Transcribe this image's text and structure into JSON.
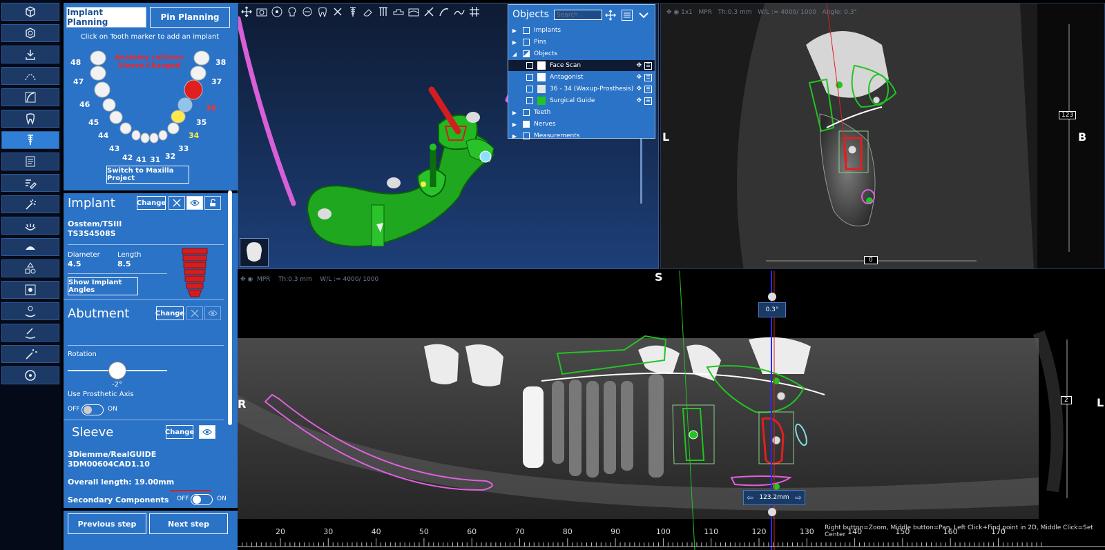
{
  "panel": {
    "tabs": [
      {
        "label": "Implant Planning"
      },
      {
        "label": "Pin Planning"
      }
    ],
    "hint": "Click on Tooth marker to add an implant",
    "warning_line1": "Anatomy collision",
    "warning_line2": "Sleeve Changed",
    "teeth": {
      "t48": "48",
      "t47": "47",
      "t46": "46",
      "t45": "45",
      "t44": "44",
      "t43": "43",
      "t42": "42",
      "t41": "41",
      "t31": "31",
      "t32": "32",
      "t33": "33",
      "t34": "34",
      "t35": "35",
      "t36": "36",
      "t37": "37",
      "t38": "38"
    },
    "switch_label": "Switch to Maxilla Project",
    "implant": {
      "title": "Implant",
      "change": "Change",
      "brand": "Osstem/TSIII",
      "model": "TS3S4508S",
      "diameter_label": "Diameter",
      "diameter": "4.5",
      "length_label": "Length",
      "length": "8.5",
      "angles_label": "Show Implant Angles"
    },
    "abutment": {
      "title": "Abutment",
      "change": "Change",
      "rotation_label": "Rotation",
      "rotation_value": "-2°",
      "rotation_fraction": 0.5,
      "prosthetic_axis_label": "Use Prosthetic Axis",
      "off": "OFF",
      "on": "ON"
    },
    "sleeve": {
      "title": "Sleeve",
      "change": "Change",
      "brand": "3Diemme/RealGUIDE",
      "model": "3DM00604CAD1.10",
      "overall_length": "Overall length: 19.00mm",
      "secondary_label": "Secondary Components",
      "off": "OFF",
      "on": "ON"
    },
    "prev_label": "Previous step",
    "next_label": "Next step"
  },
  "objects": {
    "title": "Objects",
    "search_placeholder": "Search",
    "rows": [
      {
        "label": "Implants"
      },
      {
        "label": "Pins"
      },
      {
        "label": "Objects"
      },
      {
        "label": "Face Scan"
      },
      {
        "label": "Antagonist"
      },
      {
        "label": "36 - 34 (Waxup-Prosthesis)"
      },
      {
        "label": "Surgical Guide"
      },
      {
        "label": "Teeth"
      },
      {
        "label": "Nerves"
      },
      {
        "label": "Measurements"
      }
    ],
    "colors": {
      "face_scan": "#ffffff",
      "antagonist": "#ffffff",
      "waxup": "#e6e6e6",
      "guide": "#22c422"
    }
  },
  "cross_view": {
    "zoom": "1x1",
    "mode": "MPR",
    "thickness": "Th:0.3 mm",
    "wl": "W/L := 4000/ 1000",
    "angle": "Angle: 0.3°",
    "left_letter": "L",
    "right_letter": "B",
    "slider_value": "123",
    "bottom_value": "0"
  },
  "pano_view": {
    "mode": "MPR",
    "thickness": "Th:0.3 mm",
    "wl": "W/L := 4000/ 1000",
    "top_letter": "S",
    "left_letter": "R",
    "right_letter": "L",
    "angle_badge": "0.3°",
    "slider_value": "2",
    "position": "123.2mm",
    "ruler_ticks": [
      "20",
      "30",
      "40",
      "50",
      "60",
      "70",
      "80",
      "90",
      "100",
      "110",
      "120",
      "130",
      "140",
      "150",
      "160",
      "170"
    ],
    "help": "Right button=Zoom, Middle button=Pan, Left Click+Find point in 2D, Middle Click=Set Center"
  },
  "icons": {
    "toolbar": [
      "cube-icon",
      "cube-segment-icon",
      "import-icon",
      "arch-curve-icon",
      "curve-icon",
      "tooth-icon",
      "implant-icon",
      "report-icon",
      "edit-icon",
      "wand-icon",
      "teeth-scan-icon",
      "gum-icon",
      "shapes-icon",
      "settings-icon",
      "teeth-settings-icon",
      "teeth-wand-icon",
      "magic-icon",
      "disc-icon"
    ]
  }
}
